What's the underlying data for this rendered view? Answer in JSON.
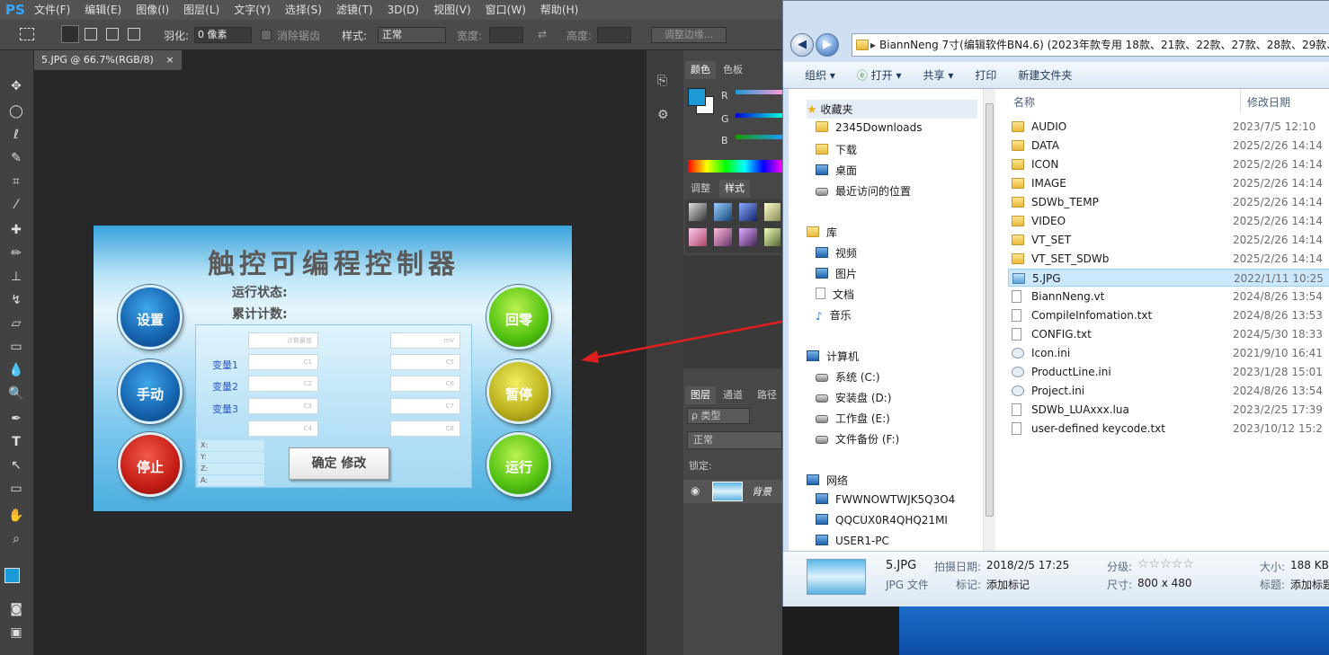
{
  "ps": {
    "logo": "PS",
    "menus": [
      "文件(F)",
      "编辑(E)",
      "图像(I)",
      "图层(L)",
      "文字(Y)",
      "选择(S)",
      "滤镜(T)",
      "3D(D)",
      "视图(V)",
      "窗口(W)",
      "帮助(H)"
    ],
    "options": {
      "feather_label": "羽化:",
      "feather_value": "0 像素",
      "antialias": "消除锯齿",
      "style_label": "样式:",
      "style_value": "正常",
      "width_label": "宽度:",
      "height_label": "高度:",
      "refine": "调整边缘..."
    },
    "doc_tab": "5.JPG @ 66.7%(RGB/8)",
    "doc_tab_close": "×",
    "panels": {
      "color_tab": "颜色",
      "swatch_tab": "色板",
      "r": "R",
      "g": "G",
      "b": "B",
      "adjust_tab": "调整",
      "styles_tab": "样式",
      "layers_tab": "图层",
      "channels_tab": "通道",
      "paths_tab": "路径",
      "kind": "ρ 类型",
      "blend": "正常",
      "lock": "锁定:",
      "layer_name": "背景"
    },
    "fg_color": "#1b9ad6"
  },
  "hmi": {
    "title": "触控可编程控制器",
    "status_label": "运行状态:",
    "count_label": "累计计数:",
    "btn_setup": "设置",
    "btn_manual": "手动",
    "btn_stop": "停止",
    "btn_home": "回零",
    "btn_pause": "暂停",
    "btn_run": "运行",
    "var1": "变量1",
    "var2": "变量2",
    "var3": "变量3",
    "fields_left": [
      "计数最值",
      "C1",
      "C2",
      "C3",
      "C4"
    ],
    "fields_right": [
      "mV",
      "C5",
      "C6",
      "C7",
      "C8"
    ],
    "xyz": [
      "X:",
      "Y:",
      "Z:",
      "A:"
    ],
    "ok": "确定 修改"
  },
  "explorer": {
    "address": "BiannNeng 7寸(编辑软件BN4.6) (2023年款专用 18款、21款、22款、27款、28款、29款、",
    "toolbar": [
      "组织 ▾",
      "打开 ▾",
      "共享 ▾",
      "打印",
      "新建文件夹"
    ],
    "nav": {
      "favorites": "收藏夹",
      "fav_items": [
        "2345Downloads",
        "下载",
        "桌面",
        "最近访问的位置"
      ],
      "library": "库",
      "lib_items": [
        "视频",
        "图片",
        "文档",
        "音乐"
      ],
      "computer": "计算机",
      "drives": [
        "系统 (C:)",
        "安装盘 (D:)",
        "工作盘 (E:)",
        "文件备份 (F:)"
      ],
      "network": "网络",
      "net_items": [
        "FWWNOWTWJK5Q3O4",
        "QQCUX0R4QHQ21MI",
        "USER1-PC"
      ]
    },
    "columns": {
      "name": "名称",
      "date": "修改日期"
    },
    "files": [
      {
        "name": "AUDIO",
        "date": "2023/7/5 12:10",
        "type": "folder"
      },
      {
        "name": "DATA",
        "date": "2025/2/26 14:14",
        "type": "folder"
      },
      {
        "name": "ICON",
        "date": "2025/2/26 14:14",
        "type": "folder"
      },
      {
        "name": "IMAGE",
        "date": "2025/2/26 14:14",
        "type": "folder"
      },
      {
        "name": "SDWb_TEMP",
        "date": "2025/2/26 14:14",
        "type": "folder"
      },
      {
        "name": "VIDEO",
        "date": "2025/2/26 14:14",
        "type": "folder"
      },
      {
        "name": "VT_SET",
        "date": "2025/2/26 14:14",
        "type": "folder"
      },
      {
        "name": "VT_SET_SDWb",
        "date": "2025/2/26 14:14",
        "type": "folder"
      },
      {
        "name": "5.JPG",
        "date": "2022/1/11 10:25",
        "type": "image"
      },
      {
        "name": "BiannNeng.vt",
        "date": "2024/8/26 13:54",
        "type": "file"
      },
      {
        "name": "CompileInfomation.txt",
        "date": "2024/8/26 13:53",
        "type": "file"
      },
      {
        "name": "CONFIG.txt",
        "date": "2024/5/30 18:33",
        "type": "file"
      },
      {
        "name": "Icon.ini",
        "date": "2021/9/10 16:41",
        "type": "cfg"
      },
      {
        "name": "ProductLine.ini",
        "date": "2023/1/28 15:01",
        "type": "cfg"
      },
      {
        "name": "Project.ini",
        "date": "2024/8/26 13:54",
        "type": "cfg"
      },
      {
        "name": "SDWb_LUAxxx.lua",
        "date": "2023/2/25 17:39",
        "type": "file"
      },
      {
        "name": "user-defined keycode.txt",
        "date": "2023/10/12 15:2",
        "type": "file"
      }
    ],
    "details": {
      "filename": "5.JPG",
      "filetype": "JPG 文件",
      "date_label": "拍摄日期:",
      "date_value": "2018/2/5 17:25",
      "tag_label": "标记:",
      "tag_value": "添加标记",
      "rating_label": "分级:",
      "rating_stars": "☆☆☆☆☆",
      "dim_label": "尺寸:",
      "dim_value": "800 x 480",
      "size_label": "大小:",
      "size_value": "188 KB",
      "title_label": "标题:",
      "title_value": "添加标题"
    }
  },
  "arrow_color": "#e02020"
}
